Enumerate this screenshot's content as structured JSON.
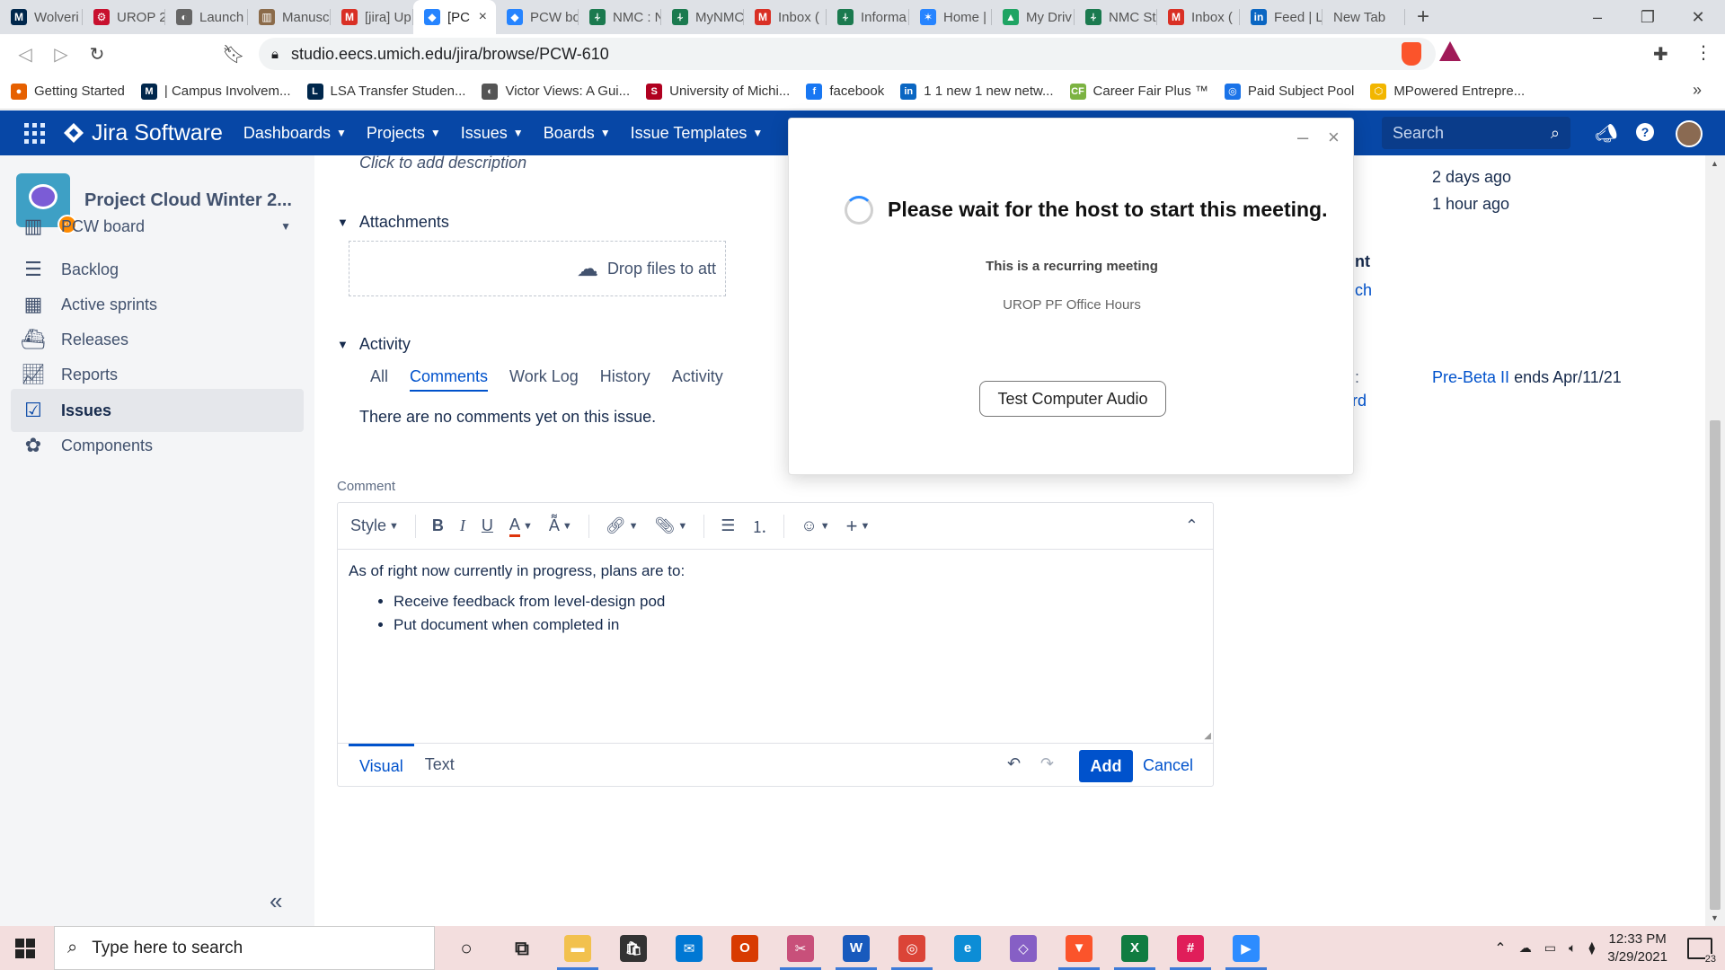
{
  "browser": {
    "tabs": [
      {
        "label": "Wolveri",
        "icon": "umich-icon",
        "color": "#00274c",
        "glyph": "M"
      },
      {
        "label": "UROP 2",
        "icon": "settings-gear-icon",
        "color": "#c8102e",
        "glyph": "⚙"
      },
      {
        "label": "Launch",
        "icon": "globe-icon",
        "color": "#666666",
        "glyph": "◐"
      },
      {
        "label": "Manusc",
        "icon": "library-icon",
        "color": "#8b6b4a",
        "glyph": "▥"
      },
      {
        "label": "[jira] Up",
        "icon": "gmail-icon",
        "color": "#d93025",
        "glyph": "M"
      },
      {
        "label": "[PC",
        "icon": "jira-icon",
        "color": "#2684ff",
        "glyph": "◆"
      },
      {
        "label": "PCW bo",
        "icon": "jira-icon",
        "color": "#2684ff",
        "glyph": "◆"
      },
      {
        "label": "NMC : N",
        "icon": "nmc-icon",
        "color": "#1b7a4f",
        "glyph": "⍭"
      },
      {
        "label": "MyNMC",
        "icon": "nmc-icon",
        "color": "#1b7a4f",
        "glyph": "⍭"
      },
      {
        "label": "Inbox (",
        "icon": "gmail-icon",
        "color": "#d93025",
        "glyph": "M"
      },
      {
        "label": "Informa",
        "icon": "nmc-icon",
        "color": "#1b7a4f",
        "glyph": "⍭"
      },
      {
        "label": "Home |",
        "icon": "confluence-icon",
        "color": "#2684ff",
        "glyph": "✶"
      },
      {
        "label": "My Driv",
        "icon": "google-drive-icon",
        "color": "#1fa463",
        "glyph": "▲"
      },
      {
        "label": "NMC St",
        "icon": "nmc-icon",
        "color": "#1b7a4f",
        "glyph": "⍭"
      },
      {
        "label": "Inbox (",
        "icon": "gmail-icon",
        "color": "#d93025",
        "glyph": "M"
      },
      {
        "label": "Feed | L",
        "icon": "linkedin-icon",
        "color": "#0a66c2",
        "glyph": "in"
      },
      {
        "label": "New Tab",
        "icon": "",
        "color": "#dee1e6",
        "glyph": ""
      }
    ],
    "active_tab_index": 5,
    "url": "studio.eecs.umich.edu/jira/browse/PCW-610",
    "bookmarks": [
      {
        "label": "Getting Started",
        "icon": "firefox-icon",
        "color": "#e66000",
        "glyph": "●"
      },
      {
        "label": "| Campus Involvem...",
        "icon": "umich-icon",
        "color": "#00274c",
        "glyph": "M"
      },
      {
        "label": "LSA Transfer Studen...",
        "icon": "lsa-icon",
        "color": "#00274c",
        "glyph": "L"
      },
      {
        "label": "Victor Views: A Gui...",
        "icon": "globe-icon",
        "color": "#555555",
        "glyph": "◐"
      },
      {
        "label": "University of Michi...",
        "icon": "umich-red-icon",
        "color": "#b00020",
        "glyph": "S"
      },
      {
        "label": "facebook",
        "icon": "facebook-icon",
        "color": "#1877f2",
        "glyph": "f"
      },
      {
        "label": "1 1 new 1 new netw...",
        "icon": "linkedin-icon",
        "color": "#0a66c2",
        "glyph": "in"
      },
      {
        "label": "Career Fair Plus ™",
        "icon": "careerfair-icon",
        "color": "#7cb342",
        "glyph": "CF"
      },
      {
        "label": "Paid Subject Pool",
        "icon": "chrome-icon",
        "color": "#1a73e8",
        "glyph": "◎"
      },
      {
        "label": "MPowered Entrepre...",
        "icon": "hexagon-icon",
        "color": "#f2b600",
        "glyph": "⬡"
      }
    ]
  },
  "jira": {
    "product_name": "Jira Software",
    "nav": [
      "Dashboards",
      "Projects",
      "Issues",
      "Boards",
      "Issue Templates"
    ],
    "search_placeholder": "Search"
  },
  "sidebar": {
    "project_name": "Project Cloud Winter 2...",
    "items": [
      {
        "label": "PCW board",
        "icon": "board-icon"
      },
      {
        "label": "Backlog",
        "icon": "backlog-icon"
      },
      {
        "label": "Active sprints",
        "icon": "sprint-icon"
      },
      {
        "label": "Releases",
        "icon": "ship-icon"
      },
      {
        "label": "Reports",
        "icon": "chart-icon"
      },
      {
        "label": "Issues",
        "icon": "issues-icon"
      },
      {
        "label": "Components",
        "icon": "puzzle-icon"
      }
    ],
    "selected_index": 5
  },
  "issue": {
    "description_placeholder": "Click to add description",
    "attachments_heading": "Attachments",
    "drop_text": "Drop files to att",
    "activity_heading": "Activity",
    "activity_tabs": [
      "All",
      "Comments",
      "Work Log",
      "History",
      "Activity"
    ],
    "active_activity_tab": 1,
    "no_comments": "There are no comments yet on this issue.",
    "comment_label": "Comment",
    "editor": {
      "style_label": "Style",
      "body_intro": "As of right now currently in progress, plans are to:",
      "bullets": [
        "Receive feedback from level-design pod",
        "Put document when completed in"
      ],
      "mode_tabs": [
        "Visual",
        "Text"
      ],
      "add_label": "Add",
      "cancel_label": "Cancel"
    },
    "right_panel": {
      "created": "2 days ago",
      "updated": "1 hour ago",
      "clip_t": "nt",
      "clip_ch": "ch",
      "clip_colon": ":",
      "clip_rd": "rd",
      "sprint_link": "Pre-Beta II",
      "sprint_suffix": "ends Apr/11/21"
    }
  },
  "zoom_popup": {
    "title": "Please wait for the host to start this meeting.",
    "recurring": "This is a recurring meeting",
    "meeting_name": "UROP PF Office Hours",
    "button": "Test Computer Audio"
  },
  "taskbar": {
    "search_placeholder": "Type here to search",
    "apps": [
      {
        "icon": "cortana-icon",
        "color": "transparent",
        "glyph": "○",
        "running": false
      },
      {
        "icon": "task-view-icon",
        "color": "transparent",
        "glyph": "⧉",
        "running": false
      },
      {
        "icon": "file-explorer-icon",
        "color": "#f2c14e",
        "glyph": "▬",
        "running": true
      },
      {
        "icon": "store-icon",
        "color": "#333333",
        "glyph": "🛍",
        "running": false
      },
      {
        "icon": "mail-icon",
        "color": "#0078d4",
        "glyph": "✉",
        "running": false
      },
      {
        "icon": "office-icon",
        "color": "#d83b01",
        "glyph": "O",
        "running": false
      },
      {
        "icon": "snip-icon",
        "color": "#c8507a",
        "glyph": "✂",
        "running": true
      },
      {
        "icon": "word-icon",
        "color": "#185abd",
        "glyph": "W",
        "running": true
      },
      {
        "icon": "chrome-icon",
        "color": "#db4437",
        "glyph": "◎",
        "running": true
      },
      {
        "icon": "edge-icon",
        "color": "#0c8dd6",
        "glyph": "e",
        "running": false
      },
      {
        "icon": "visual-studio-icon",
        "color": "#865fc5",
        "glyph": "◇",
        "running": false
      },
      {
        "icon": "brave-icon",
        "color": "#fb542b",
        "glyph": "▼",
        "running": true
      },
      {
        "icon": "excel-icon",
        "color": "#107c41",
        "glyph": "X",
        "running": true
      },
      {
        "icon": "slack-icon",
        "color": "#e01e5a",
        "glyph": "#",
        "running": true
      },
      {
        "icon": "zoom-icon",
        "color": "#2d8cff",
        "glyph": "▶",
        "running": true
      }
    ],
    "time": "12:33 PM",
    "date": "3/29/2021",
    "notification_count": "23"
  }
}
